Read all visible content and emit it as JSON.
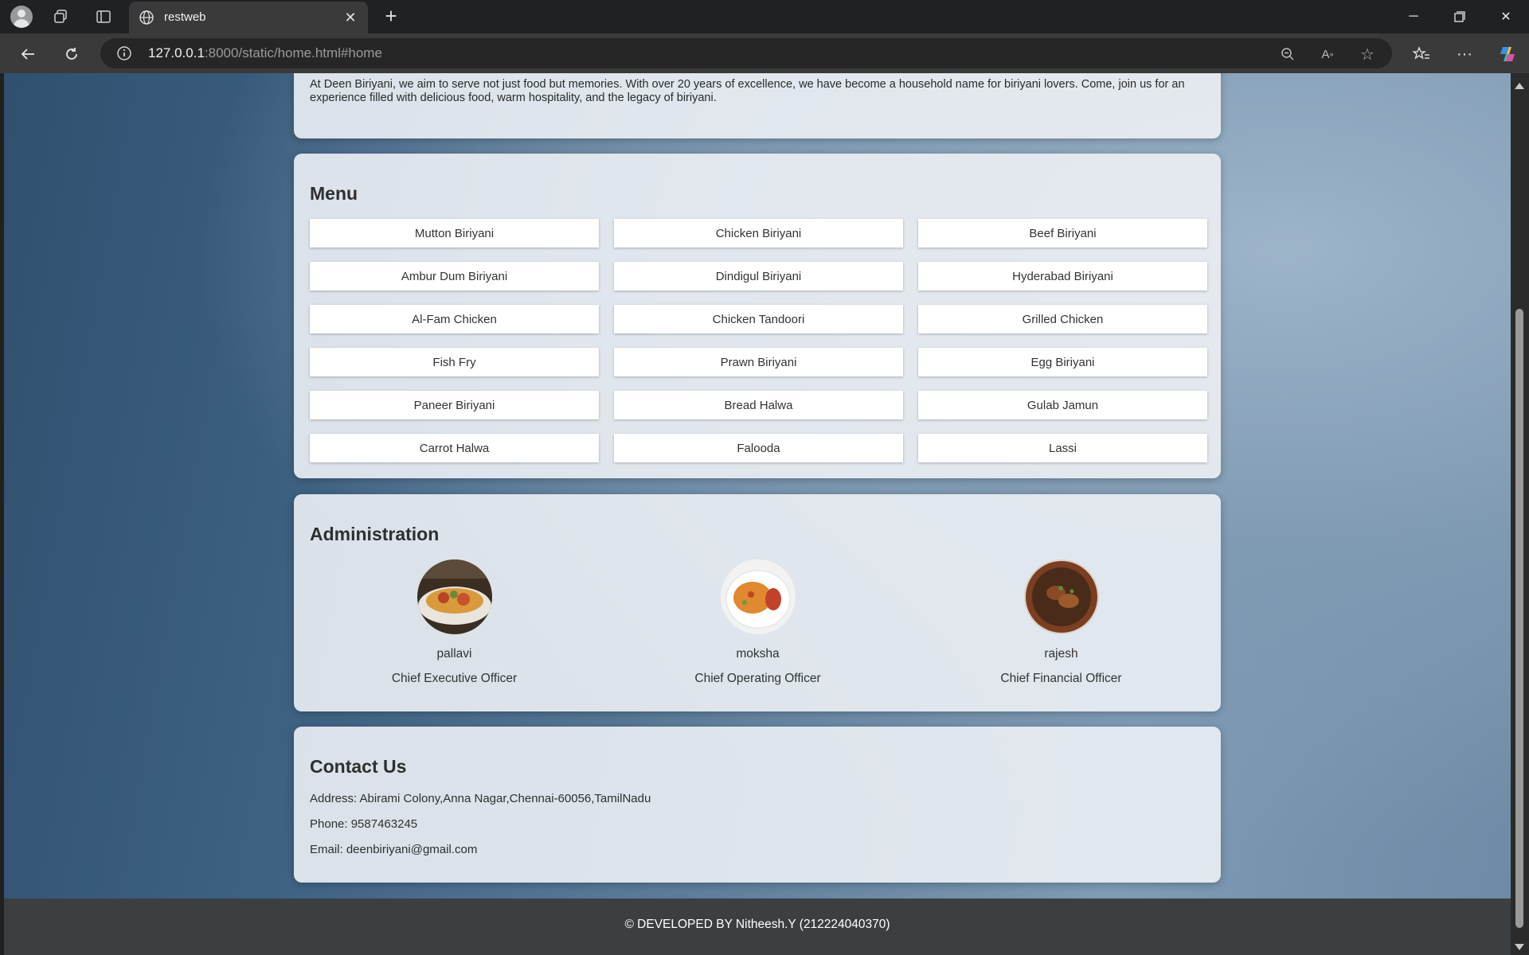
{
  "browser": {
    "tab_title": "restweb",
    "url_host": "127.0.0.1",
    "url_rest": ":8000/static/home.html#home"
  },
  "about": {
    "text": "At Deen Biriyani, we aim to serve not just food but memories. With over 20 years of excellence, we have become a household name for biriyani lovers. Come, join us for an experience filled with delicious food, warm hospitality, and the legacy of biriyani."
  },
  "menu": {
    "heading": "Menu",
    "items": [
      "Mutton Biriyani",
      "Chicken Biriyani",
      "Beef Biriyani",
      "Ambur Dum Biriyani",
      "Dindigul Biriyani",
      "Hyderabad Biriyani",
      "Al-Fam Chicken",
      "Chicken Tandoori",
      "Grilled Chicken",
      "Fish Fry",
      "Prawn Biriyani",
      "Egg Biriyani",
      "Paneer Biriyani",
      "Bread Halwa",
      "Gulab Jamun",
      "Carrot Halwa",
      "Falooda",
      "Lassi"
    ]
  },
  "admin": {
    "heading": "Administration",
    "people": [
      {
        "name": "pallavi",
        "role": "Chief Executive Officer"
      },
      {
        "name": "moksha",
        "role": "Chief Operating Officer"
      },
      {
        "name": "rajesh",
        "role": "Chief Financial Officer"
      }
    ]
  },
  "contact": {
    "heading": "Contact Us",
    "address": "Address: Abirami Colony,Anna Nagar,Chennai-60056,TamilNadu",
    "phone": "Phone: 9587463245",
    "email": "Email: deenbiriyani@gmail.com"
  },
  "footer": {
    "text": "© DEVELOPED BY Nitheesh.Y (212224040370)"
  }
}
